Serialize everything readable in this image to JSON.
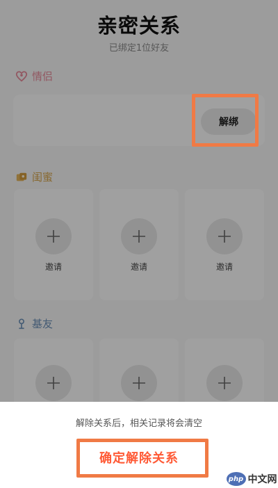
{
  "page": {
    "title": "亲密关系",
    "subtitle": "已绑定1位好友"
  },
  "sections": {
    "lover": {
      "label": "情侣",
      "icon": "heart-icon",
      "unbind_label": "解绑"
    },
    "bestie": {
      "label": "闺蜜",
      "icon": "bestie-icon",
      "slots": [
        {
          "label": "邀请"
        },
        {
          "label": "邀请"
        },
        {
          "label": "邀请"
        }
      ]
    },
    "buddy": {
      "label": "基友",
      "icon": "buddy-icon",
      "slots": [
        {
          "label": ""
        },
        {
          "label": ""
        },
        {
          "label": ""
        }
      ]
    }
  },
  "sheet": {
    "message": "解除关系后，相关记录将会清空",
    "confirm_label": "确定解除关系"
  },
  "watermark": {
    "logo_text": "php",
    "text": "中文网"
  },
  "colors": {
    "highlight": "#f07a45",
    "confirm": "#ff5a36"
  }
}
